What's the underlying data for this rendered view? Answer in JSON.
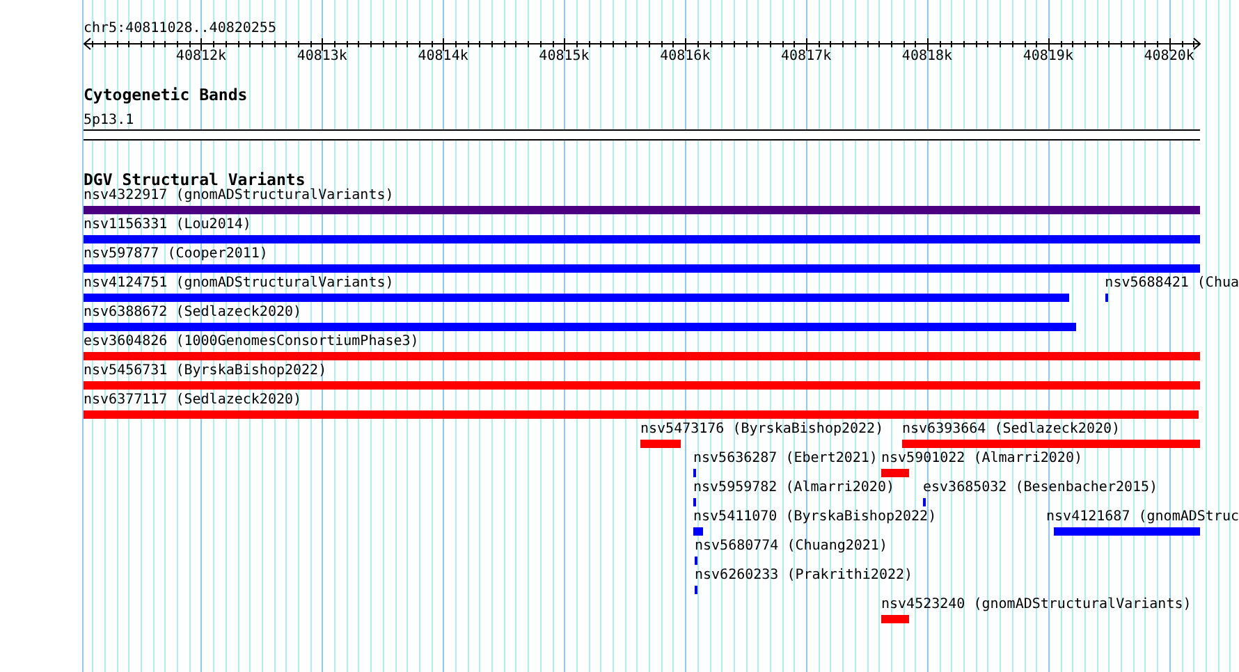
{
  "ruler": {
    "location": "chr5:40811028..40820255",
    "ticks": [
      {
        "label": "40812k"
      },
      {
        "label": "40813k"
      },
      {
        "label": "40814k"
      },
      {
        "label": "40815k"
      },
      {
        "label": "40816k"
      },
      {
        "label": "40817k"
      },
      {
        "label": "40818k"
      },
      {
        "label": "40819k"
      },
      {
        "label": "40820k"
      }
    ]
  },
  "tracks": [
    {
      "kind": "cytoband",
      "title": "Cytogenetic Bands",
      "bands": [
        {
          "name": "5p13.1"
        }
      ]
    },
    {
      "kind": "variants",
      "title": "DGV Structural Variants",
      "rows": [
        [
          {
            "label": "nsv4322917 (gnomADStructuralVariants)",
            "color": "#4b0082"
          }
        ],
        [
          {
            "label": "nsv1156331 (Lou2014)",
            "color": "#0000ff"
          }
        ],
        [
          {
            "label": "nsv597877 (Cooper2011)",
            "color": "#0000ff"
          }
        ],
        [
          {
            "label": "nsv4124751 (gnomADStructuralVariants)",
            "color": "#0000ff"
          },
          {
            "label": "nsv5688421 (Chua",
            "color": "#0000ff"
          }
        ],
        [
          {
            "label": "nsv6388672 (Sedlazeck2020)",
            "color": "#0000ff"
          }
        ],
        [
          {
            "label": "esv3604826 (1000GenomesConsortiumPhase3)",
            "color": "#ff0000"
          }
        ],
        [
          {
            "label": "nsv5456731 (ByrskaBishop2022)",
            "color": "#ff0000"
          }
        ],
        [
          {
            "label": "nsv6377117 (Sedlazeck2020)",
            "color": "#ff0000"
          }
        ],
        [
          {
            "label": "nsv5473176 (ByrskaBishop2022)",
            "color": "#ff0000"
          },
          {
            "label": "nsv6393664 (Sedlazeck2020)",
            "color": "#ff0000"
          }
        ],
        [
          {
            "label": "nsv5636287 (Ebert2021)",
            "color": "#0000ff"
          },
          {
            "label": "nsv5901022 (Almarri2020)",
            "color": "#ff0000"
          }
        ],
        [
          {
            "label": "nsv5959782 (Almarri2020)",
            "color": "#0000ff"
          },
          {
            "label": "esv3685032 (Besenbacher2015)",
            "color": "#0000ff"
          }
        ],
        [
          {
            "label": "nsv5411070 (ByrskaBishop2022)",
            "color": "#0000ff"
          },
          {
            "label": "nsv4121687 (gnomADStruc",
            "color": "#0000ff"
          }
        ],
        [
          {
            "label": "nsv5680774 (Chuang2021)",
            "color": "#0000ff"
          }
        ],
        [
          {
            "label": "nsv6260233 (Prakrithi2022)",
            "color": "#0000ff"
          }
        ],
        [
          {
            "label": "nsv4523240 (gnomADStructuralVariants)",
            "color": "#ff0000"
          }
        ]
      ]
    }
  ]
}
